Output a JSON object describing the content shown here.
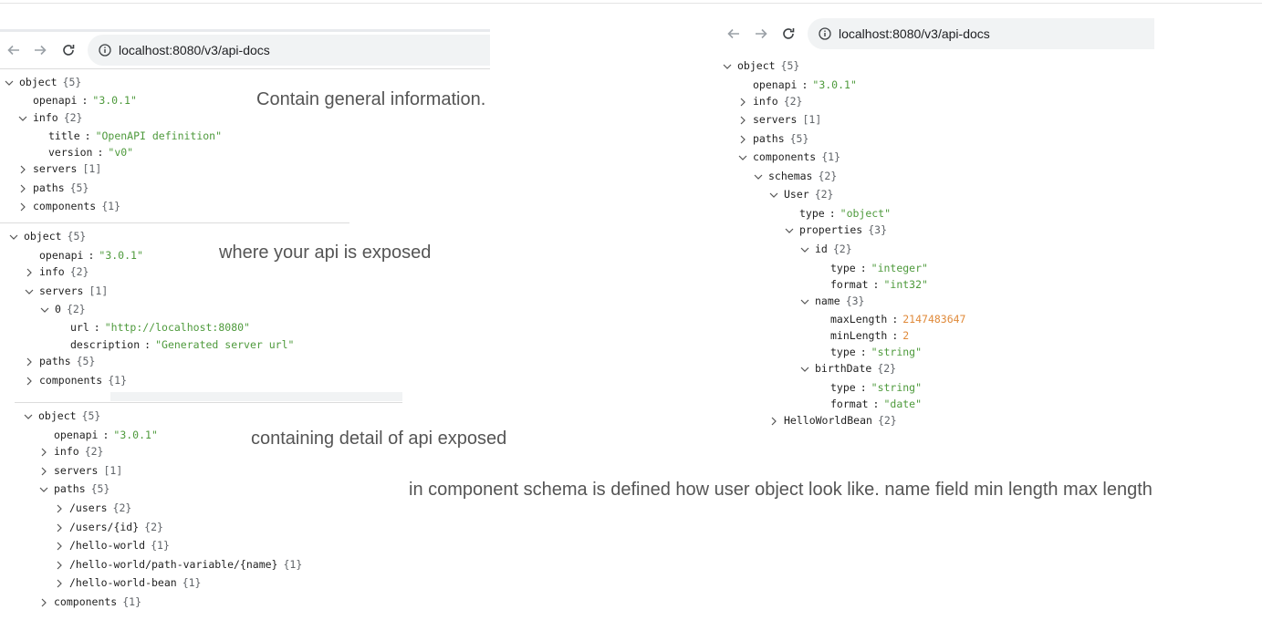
{
  "browser": {
    "url": "localhost:8080/v3/api-docs"
  },
  "annotations": {
    "general": "Contain general information.",
    "servers": "where your api is exposed",
    "paths": "containing detail of api exposed",
    "components": "in component schema is defined  how user object look like. name field min length max length"
  },
  "panel1": {
    "object": {
      "key": "object",
      "count": "{5}"
    },
    "openapi": {
      "key": "openapi",
      "value": "\"3.0.1\""
    },
    "info": {
      "key": "info",
      "count": "{2}"
    },
    "title": {
      "key": "title",
      "value": "\"OpenAPI definition\""
    },
    "version": {
      "key": "version",
      "value": "\"v0\""
    },
    "servers": {
      "key": "servers",
      "count": "[1]"
    },
    "paths": {
      "key": "paths",
      "count": "{5}"
    },
    "components": {
      "key": "components",
      "count": "{1}"
    }
  },
  "panel2": {
    "object": {
      "key": "object",
      "count": "{5}"
    },
    "openapi": {
      "key": "openapi",
      "value": "\"3.0.1\""
    },
    "info": {
      "key": "info",
      "count": "{2}"
    },
    "servers": {
      "key": "servers",
      "count": "[1]"
    },
    "zero": {
      "key": "0",
      "count": "{2}"
    },
    "url": {
      "key": "url",
      "value": "\"http://localhost:8080\""
    },
    "description": {
      "key": "description",
      "value": "\"Generated server url\""
    },
    "paths": {
      "key": "paths",
      "count": "{5}"
    },
    "components": {
      "key": "components",
      "count": "{1}"
    }
  },
  "panel3": {
    "object": {
      "key": "object",
      "count": "{5}"
    },
    "openapi": {
      "key": "openapi",
      "value": "\"3.0.1\""
    },
    "info": {
      "key": "info",
      "count": "{2}"
    },
    "servers": {
      "key": "servers",
      "count": "[1]"
    },
    "paths": {
      "key": "paths",
      "count": "{5}"
    },
    "users": {
      "key": "/users",
      "count": "{2}"
    },
    "users_id": {
      "key": "/users/{id}",
      "count": "{2}"
    },
    "hello_world": {
      "key": "/hello-world",
      "count": "{1}"
    },
    "hello_world_pv": {
      "key": "/hello-world/path-variable/{name}",
      "count": "{1}"
    },
    "hello_world_bean": {
      "key": "/hello-world-bean",
      "count": "{1}"
    },
    "components": {
      "key": "components",
      "count": "{1}"
    }
  },
  "panel4": {
    "object": {
      "key": "object",
      "count": "{5}"
    },
    "openapi": {
      "key": "openapi",
      "value": "\"3.0.1\""
    },
    "info": {
      "key": "info",
      "count": "{2}"
    },
    "servers": {
      "key": "servers",
      "count": "[1]"
    },
    "paths": {
      "key": "paths",
      "count": "{5}"
    },
    "components": {
      "key": "components",
      "count": "{1}"
    },
    "schemas": {
      "key": "schemas",
      "count": "{2}"
    },
    "user": {
      "key": "User",
      "count": "{2}"
    },
    "user_type": {
      "key": "type",
      "value": "\"object\""
    },
    "properties": {
      "key": "properties",
      "count": "{3}"
    },
    "id": {
      "key": "id",
      "count": "{2}"
    },
    "id_type": {
      "key": "type",
      "value": "\"integer\""
    },
    "id_format": {
      "key": "format",
      "value": "\"int32\""
    },
    "name": {
      "key": "name",
      "count": "{3}"
    },
    "name_max": {
      "key": "maxLength",
      "value": "2147483647"
    },
    "name_min": {
      "key": "minLength",
      "value": "2"
    },
    "name_type": {
      "key": "type",
      "value": "\"string\""
    },
    "birth": {
      "key": "birthDate",
      "count": "{2}"
    },
    "birth_type": {
      "key": "type",
      "value": "\"string\""
    },
    "birth_format": {
      "key": "format",
      "value": "\"date\""
    },
    "hello_bean": {
      "key": "HelloWorldBean",
      "count": "{2}"
    }
  }
}
